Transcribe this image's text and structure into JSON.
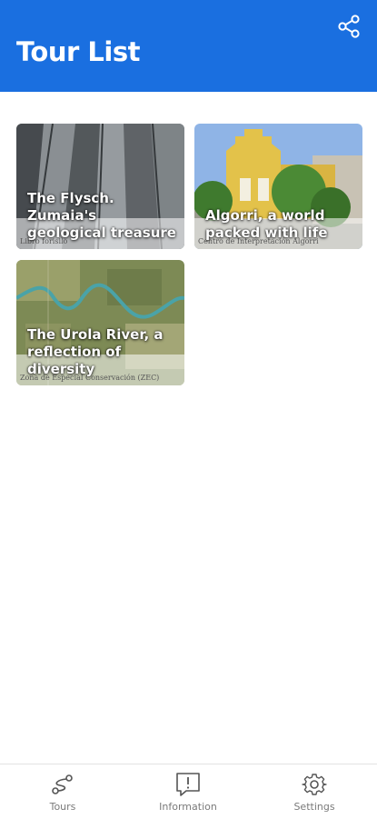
{
  "header": {
    "title": "Tour List",
    "share_icon": "share-icon"
  },
  "tours": [
    {
      "title": "The Flysch. Zumaia's geological treasure",
      "caption": "Libro forisilo"
    },
    {
      "title": "Algorri, a world packed with life",
      "caption": "Centro de Interpretación Algorri"
    },
    {
      "title": "The Urola River, a reflection of diversity",
      "caption": "Zona de Especial Conservación (ZEC)"
    }
  ],
  "bottom_nav": [
    {
      "label": "Tours",
      "icon": "route-icon"
    },
    {
      "label": "Information",
      "icon": "info-message-icon"
    },
    {
      "label": "Settings",
      "icon": "gear-icon"
    }
  ],
  "colors": {
    "app_bar": "#1a6fe0",
    "nav_label": "#7a7a7a"
  }
}
